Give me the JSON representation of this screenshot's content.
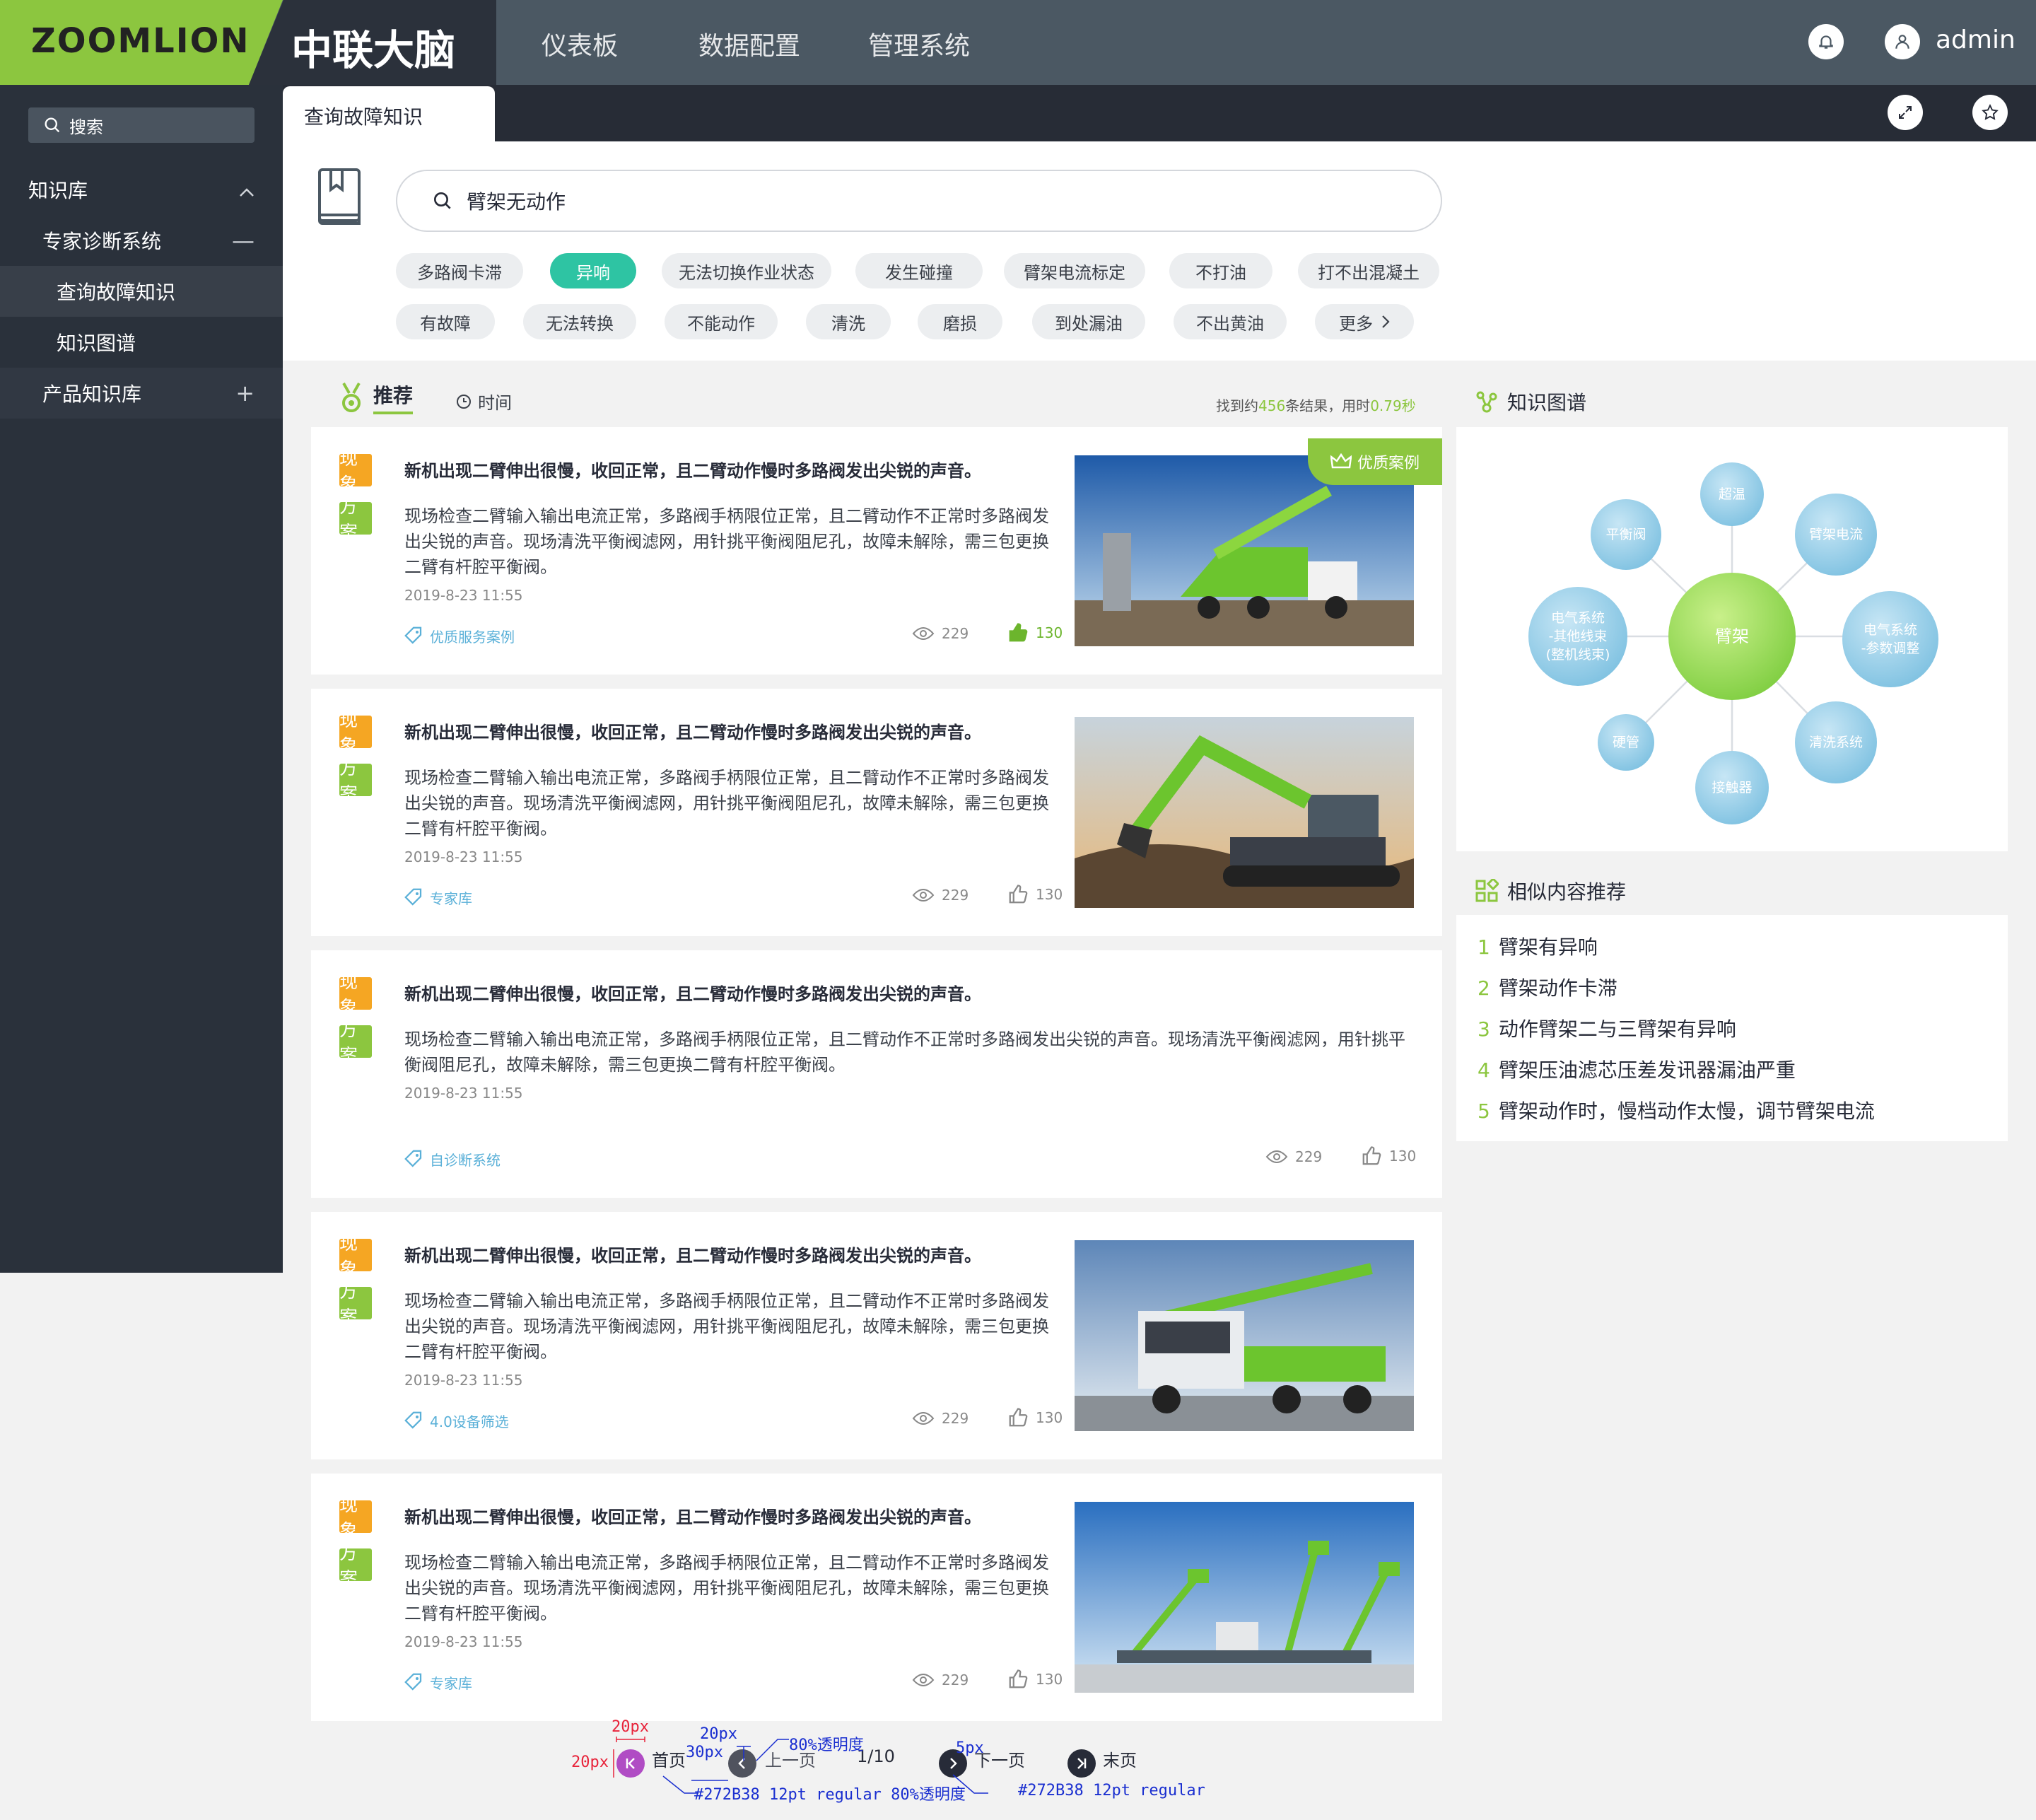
{
  "header": {
    "brand": "ZOOMLION",
    "product_title": "中联大脑",
    "nav": [
      "仪表板",
      "数据配置",
      "管理系统"
    ],
    "user": "admin",
    "brand_color": "#8cc63f"
  },
  "tabs": {
    "active": "查询故障知识"
  },
  "sidebar": {
    "search_placeholder": "搜索",
    "items": [
      {
        "label": "知识库",
        "icon": "chevron-up-icon"
      },
      {
        "label": "专家诊断系统",
        "icon": "minus-icon"
      },
      {
        "label": "查询故障知识",
        "selected": true
      },
      {
        "label": "知识图谱"
      },
      {
        "label": "产品知识库",
        "icon": "plus-icon"
      }
    ]
  },
  "search": {
    "query": "臂架无动作"
  },
  "tags": {
    "row1": [
      "多路阀卡滞",
      "异响",
      "无法切换作业状态",
      "发生碰撞",
      "臂架电流标定",
      "不打油",
      "打不出混凝土"
    ],
    "row2": [
      "有故障",
      "无法转换",
      "不能动作",
      "清洗",
      "磨损",
      "到处漏油",
      "不出黄油",
      "更多"
    ],
    "active": "异响"
  },
  "sort": {
    "recommend": "推荐",
    "time": "时间"
  },
  "result_info": {
    "prefix": "找到约",
    "count": "456",
    "middle": "条结果，用时",
    "time": "0.79秒"
  },
  "badges": {
    "phenomenon": "现象",
    "solution": "方案"
  },
  "premium_label": "优质案例",
  "cards": [
    {
      "title": "新机出现二臂伸出很慢，收回正常，且二臂动作慢时多路阀发出尖锐的声音。",
      "body": "现场检查二臂输入输出电流正常，多路阀手柄限位正常，且二臂动作不正常时多路阀发出尖锐的声音。现场清洗平衡阀滤网，用针挑平衡阀阻尼孔，故障未解除，需三包更换二臂有杆腔平衡阀。",
      "date": "2019-8-23 11:55",
      "tag": "优质服务案例",
      "views": "229",
      "likes": "130",
      "liked": true,
      "image": "crane"
    },
    {
      "title": "新机出现二臂伸出很慢，收回正常，且二臂动作慢时多路阀发出尖锐的声音。",
      "body": "现场检查二臂输入输出电流正常，多路阀手柄限位正常，且二臂动作不正常时多路阀发出尖锐的声音。现场清洗平衡阀滤网，用针挑平衡阀阻尼孔，故障未解除，需三包更换二臂有杆腔平衡阀。",
      "date": "2019-8-23 11:55",
      "tag": "专家库",
      "views": "229",
      "likes": "130",
      "liked": false,
      "image": "excavator"
    },
    {
      "title": "新机出现二臂伸出很慢，收回正常，且二臂动作慢时多路阀发出尖锐的声音。",
      "body": "现场检查二臂输入输出电流正常，多路阀手柄限位正常，且二臂动作不正常时多路阀发出尖锐的声音。现场清洗平衡阀滤网，用针挑平衡阀阻尼孔，故障未解除，需三包更换二臂有杆腔平衡阀。",
      "date": "2019-8-23 11:55",
      "tag": "自诊断系统",
      "views": "229",
      "likes": "130",
      "liked": false,
      "image": ""
    },
    {
      "title": "新机出现二臂伸出很慢，收回正常，且二臂动作慢时多路阀发出尖锐的声音。",
      "body": "现场检查二臂输入输出电流正常，多路阀手柄限位正常，且二臂动作不正常时多路阀发出尖锐的声音。现场清洗平衡阀滤网，用针挑平衡阀阻尼孔，故障未解除，需三包更换二臂有杆腔平衡阀。",
      "date": "2019-8-23 11:55",
      "tag": "4.0设备筛选",
      "views": "229",
      "likes": "130",
      "liked": false,
      "image": "pump-truck"
    },
    {
      "title": "新机出现二臂伸出很慢，收回正常，且二臂动作慢时多路阀发出尖锐的声音。",
      "body": "现场检查二臂输入输出电流正常，多路阀手柄限位正常，且二臂动作不正常时多路阀发出尖锐的声音。现场清洗平衡阀滤网，用针挑平衡阀阻尼孔，故障未解除，需三包更换二臂有杆腔平衡阀。",
      "date": "2019-8-23 11:55",
      "tag": "专家库",
      "views": "229",
      "likes": "130",
      "liked": false,
      "image": "aerial-platforms"
    }
  ],
  "knowledge_graph": {
    "title": "知识图谱",
    "center": "臂架",
    "nodes": [
      "超温",
      "臂架电流",
      "电气系统\n-参数调整",
      "清洗系统",
      "接触器",
      "硬管",
      "电气系统\n-其他线束\n(整机线束)",
      "平衡阀"
    ]
  },
  "similar": {
    "title": "相似内容推荐",
    "items": [
      "臂架有异响",
      "臂架动作卡滞",
      "动作臂架二与三臂架有异响",
      "臂架压油滤芯压差发讯器漏油严重",
      "臂架动作时，慢档动作太慢，调节臂架电流"
    ]
  },
  "pagination": {
    "first": "首页",
    "prev": "上一页",
    "current": "1/10",
    "next": "下一页",
    "last": "末页"
  },
  "annotations": {
    "a1": "20px",
    "a2": "20px",
    "a3": "20px",
    "a4": "30px",
    "a5": "80%透明度",
    "a6": "5px",
    "a7": "#272B38 12pt regular 80%透明度",
    "a8": "#272B38 12pt regular"
  }
}
